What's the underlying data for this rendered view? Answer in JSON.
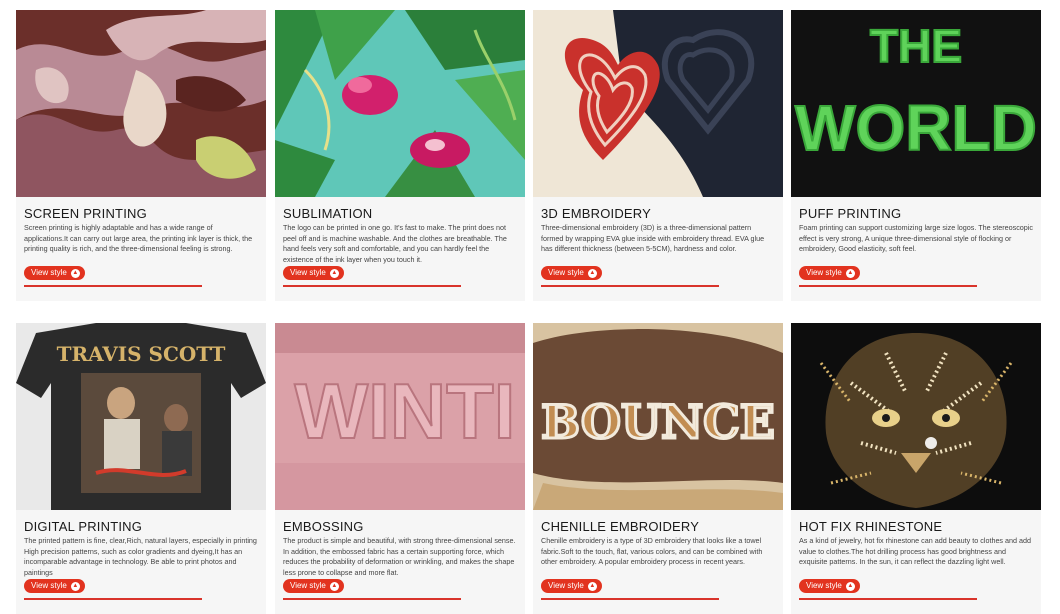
{
  "cards": [
    {
      "title": "SCREEN PRINTING",
      "desc": "Screen printing is highly adaptable and has a wide range of applications.It can carry out large area, the printing ink layer is thick, the printing quality is rich, and the three-dimensional feeling is strong.",
      "button": "View style"
    },
    {
      "title": "SUBLIMATION",
      "desc": "The logo can be printed in one go. It's fast to make. The print does not peel off and is machine washable. And the clothes are breathable. The hand feels very soft and comfortable, and you can hardly feel the existence of the ink layer when you touch it.",
      "button": "View style"
    },
    {
      "title": "3D EMBROIDERY",
      "desc": "Three-dimensional embroidery (3D) is a three-dimensional pattern formed by wrapping EVA glue inside with embroidery thread. EVA glue has different thickness (between 5-5CM), hardness and color.",
      "button": "View style"
    },
    {
      "title": "PUFF PRINTING",
      "desc": "Foam printing can support customizing large size logos. The stereoscopic effect is very strong, A unique three-dimensional style of flocking or embroidery, Good elasticity, soft feel.",
      "button": "View style"
    },
    {
      "title": "DIGITAL PRINTING",
      "desc": "The printed pattern is fine, clear,Rich, natural layers, especially in printing High precision patterns, such as color gradients and dyeing,It has an incomparable advantage in technology. Be able to print photos and paintings",
      "button": "View style"
    },
    {
      "title": "EMBOSSING",
      "desc": "The product is simple and beautiful, with strong three-dimensional sense. In addition, the embossed fabric has a certain supporting force, which reduces the probability of deformation or wrinkling, and makes the shape less prone to collapse and more flat.",
      "button": "View style"
    },
    {
      "title": "CHENILLE EMBROIDERY",
      "desc": "Chenille embroidery is a type of 3D embroidery that looks like a towel fabric.Soft to the touch, flat, various colors, and can be combined with other embroidery. A popular embroidery process in recent years.",
      "button": "View style"
    },
    {
      "title": "HOT FIX RHINESTONE",
      "desc": "As a kind of jewelry, hot fix rhinestone can add beauty to clothes and add value to clothes.The hot drilling process has good brightness and exquisite patterns. In the sun, it can reflect the dazzling light well.",
      "button": "View style"
    }
  ],
  "image_text": {
    "puff": [
      "THE",
      "WORLD"
    ],
    "digital": "TRAVIS SCOTT",
    "embossing": "WINTI",
    "chenille": "BOUNCE"
  }
}
